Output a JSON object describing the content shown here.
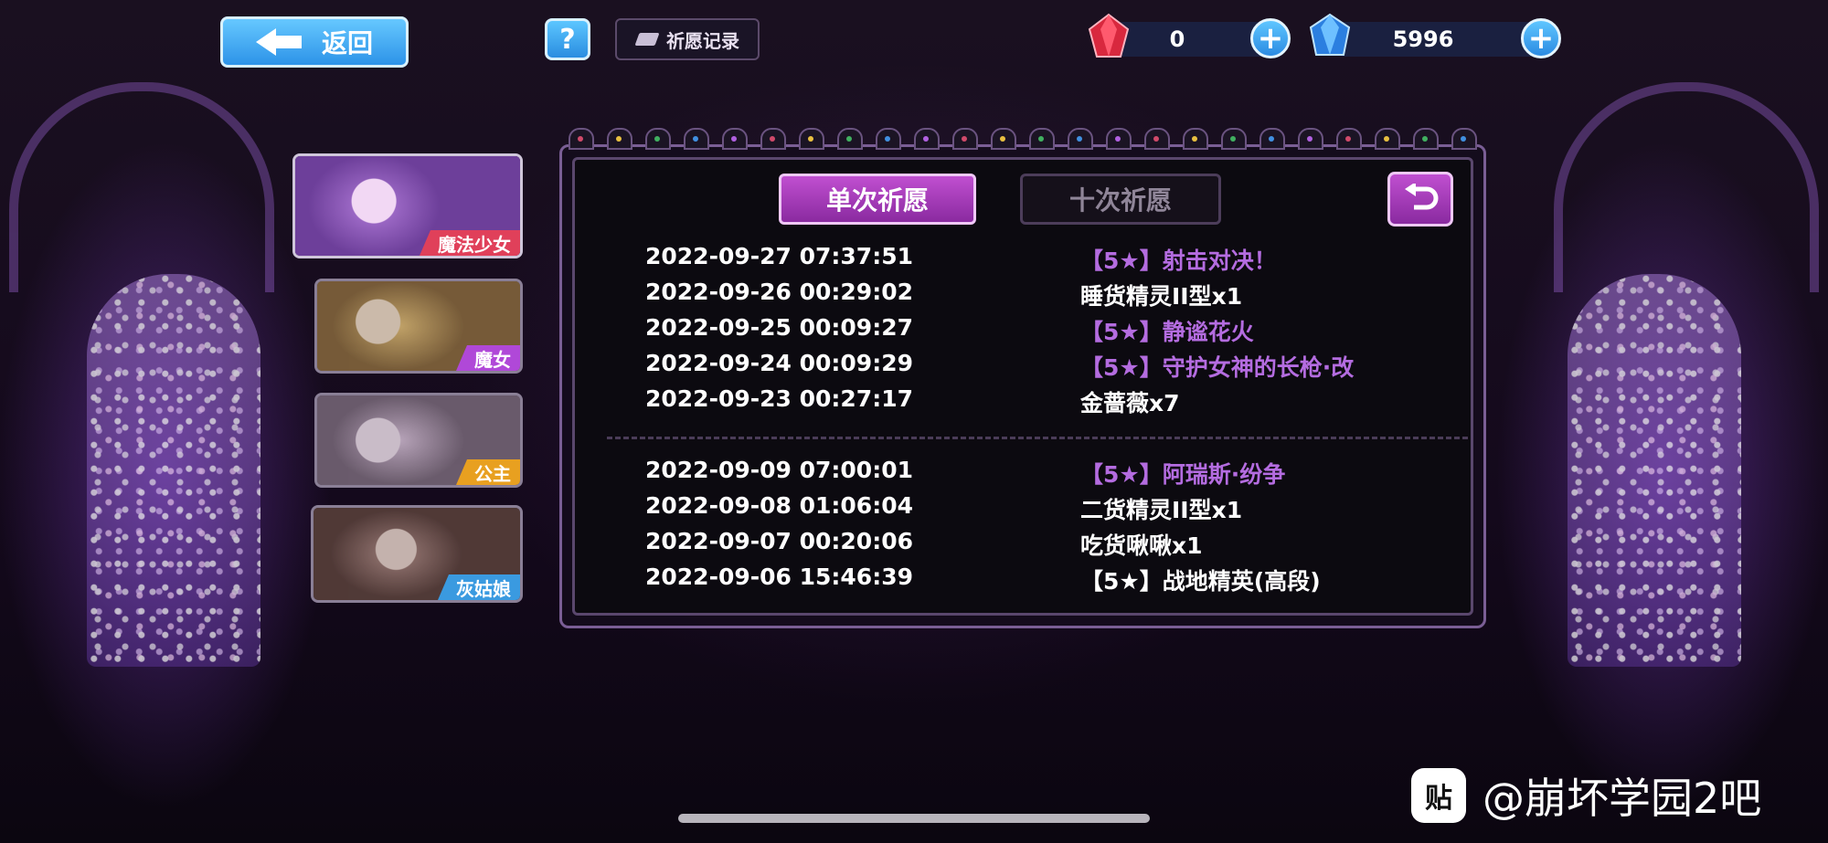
{
  "header": {
    "back_label": "返回",
    "help_label": "?",
    "record_label": "祈愿记录"
  },
  "currencies": [
    {
      "name": "red-gem",
      "value": "0",
      "color": "#e0304a"
    },
    {
      "name": "blue-crystal",
      "value": "5996",
      "color": "#3aa0ff"
    }
  ],
  "characters": [
    {
      "label": "魔法少女",
      "tag_color": "#e0405a"
    },
    {
      "label": "魔女",
      "tag_color": "#b048d8"
    },
    {
      "label": "公主",
      "tag_color": "#e8a020"
    },
    {
      "label": "灰姑娘",
      "tag_color": "#3a9ae0"
    }
  ],
  "tabs": {
    "single": "单次祈愿",
    "ten": "十次祈愿"
  },
  "records": {
    "group1": [
      {
        "time": "2022-09-27 07:37:51",
        "item": "【5★】射击对决！",
        "rarity": "5"
      },
      {
        "time": "2022-09-26 00:29:02",
        "item": "睡货精灵II型x1",
        "rarity": ""
      },
      {
        "time": "2022-09-25 00:09:27",
        "item": "【5★】静谧花火",
        "rarity": "5"
      },
      {
        "time": "2022-09-24 00:09:29",
        "item": "【5★】守护女神的长枪·改",
        "rarity": "5"
      },
      {
        "time": "2022-09-23 00:27:17",
        "item": "金蔷薇x7",
        "rarity": ""
      }
    ],
    "group2": [
      {
        "time": "2022-09-09 07:00:01",
        "item": "【5★】阿瑞斯·纷争",
        "rarity": "5"
      },
      {
        "time": "2022-09-08 01:06:04",
        "item": "二货精灵II型x1",
        "rarity": ""
      },
      {
        "time": "2022-09-07 00:20:06",
        "item": "吃货啾啾x1",
        "rarity": ""
      },
      {
        "time": "2022-09-06 15:46:39",
        "item": "【5★】战地精英(高段)",
        "rarity": ""
      }
    ]
  },
  "watermark": {
    "logo": "贴",
    "text": "@崩坏学园2吧"
  }
}
